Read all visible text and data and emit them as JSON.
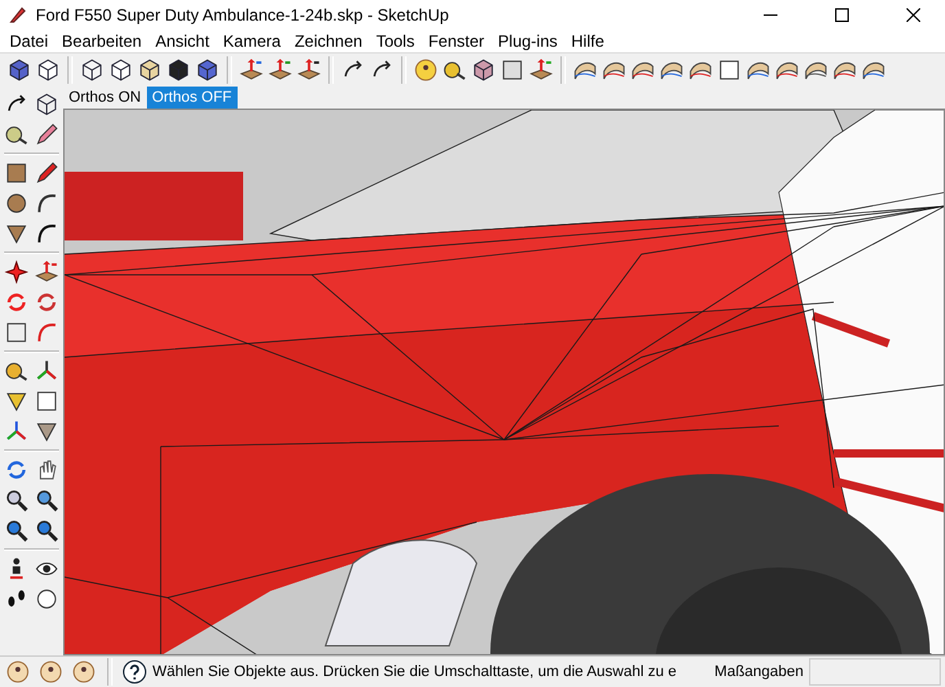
{
  "window": {
    "title": "Ford F550 Super Duty Ambulance-1-24b.skp - SketchUp"
  },
  "menu": [
    "Datei",
    "Bearbeiten",
    "Ansicht",
    "Kamera",
    "Zeichnen",
    "Tools",
    "Fenster",
    "Plug-ins",
    "Hilfe"
  ],
  "ortho_tabs": [
    {
      "label": "Orthos ON",
      "selected": false
    },
    {
      "label": "Orthos OFF",
      "selected": true
    }
  ],
  "status_bar": {
    "hint": "Wählen Sie Objekte aus. Drücken Sie die Umschalttaste, um die Auswahl zu e",
    "measurements_label": "Maßangaben"
  }
}
